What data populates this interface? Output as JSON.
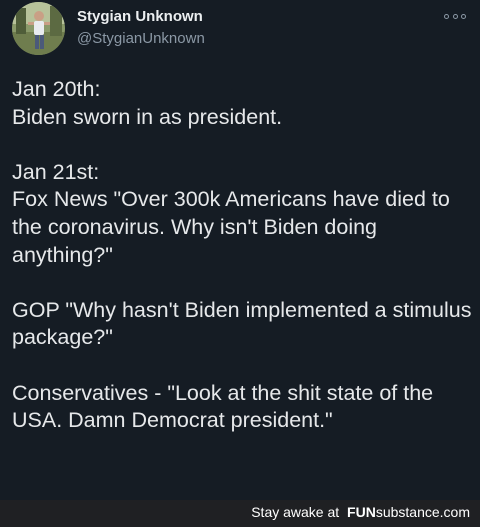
{
  "tweet": {
    "display_name": "Stygian Unknown",
    "handle": "@StygianUnknown",
    "more_icon": "more-options-icon",
    "paragraphs": [
      "Jan 20th:\nBiden sworn in as president.",
      "Jan 21st:\nFox News \"Over 300k Americans have died to the coronavirus. Why isn't Biden doing anything?\"",
      "GOP \"Why hasn't Biden implemented a stimulus package?\"",
      "Conservatives - \"Look at the shit state of the USA. Damn Democrat president.\""
    ]
  },
  "footer": {
    "watermark_prefix": "Stay awake at",
    "brand_fun": "FUN",
    "brand_substance": "substance",
    "brand_tld": ".com"
  },
  "colors": {
    "background": "#151c24",
    "text": "#e6e8ea",
    "secondary_text": "#8b98a5",
    "footer_bar": "#1f2023"
  }
}
